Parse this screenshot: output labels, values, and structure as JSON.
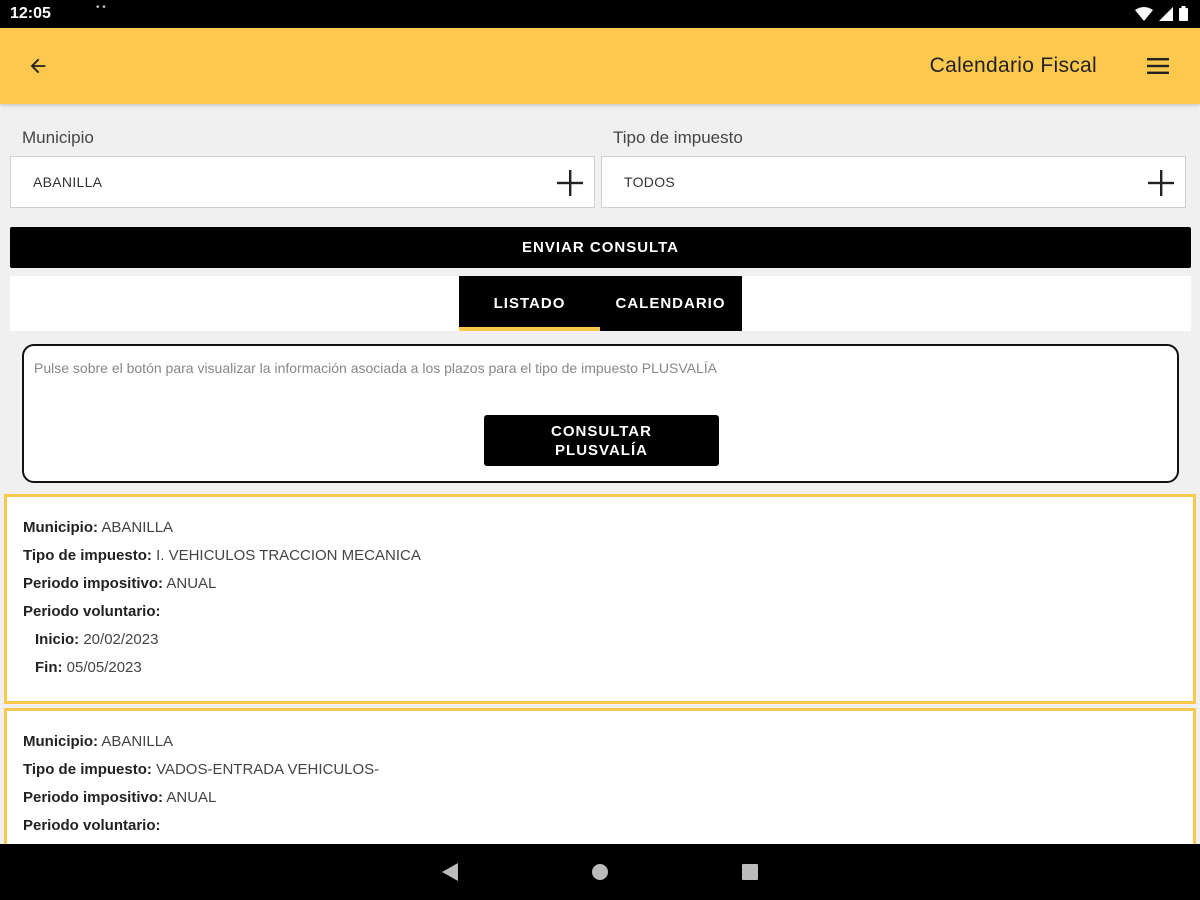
{
  "status_bar": {
    "time": "12:05",
    "dots": "• •"
  },
  "app_bar": {
    "title": "Calendario Fiscal",
    "back_icon": "arrow-back-icon",
    "menu_icon": "hamburger-menu-icon"
  },
  "filters": {
    "municipio": {
      "label": "Municipio",
      "value": "ABANILLA"
    },
    "tipo": {
      "label": "Tipo de impuesto",
      "value": "TODOS"
    }
  },
  "send_button": "ENVIAR CONSULTA",
  "tabs": [
    {
      "label": "LISTADO",
      "active": true
    },
    {
      "label": "CALENDARIO",
      "active": false
    }
  ],
  "info": {
    "text": "Pulse sobre el botón para visualizar la información asociada a los plazos para el tipo de impuesto PLUSVALÍA",
    "button_line1": "CONSULTAR",
    "button_line2": "PLUSVALÍA"
  },
  "cards": [
    {
      "municipio_key": "Municipio:",
      "municipio": "ABANILLA",
      "tipo_key": "Tipo de impuesto:",
      "tipo": "I. VEHICULOS TRACCION MECANICA",
      "periodo_key": "Periodo impositivo:",
      "periodo": "ANUAL",
      "voluntario_key": "Periodo voluntario:",
      "inicio_key": "Inicio:",
      "inicio": "20/02/2023",
      "fin_key": "Fin:",
      "fin": "05/05/2023"
    },
    {
      "municipio_key": "Municipio:",
      "municipio": "ABANILLA",
      "tipo_key": "Tipo de impuesto:",
      "tipo": "VADOS-ENTRADA VEHICULOS-",
      "periodo_key": "Periodo impositivo:",
      "periodo": "ANUAL",
      "voluntario_key": "Periodo voluntario:"
    }
  ],
  "colors": {
    "accent": "#fdc84e",
    "dark": "#000000"
  }
}
